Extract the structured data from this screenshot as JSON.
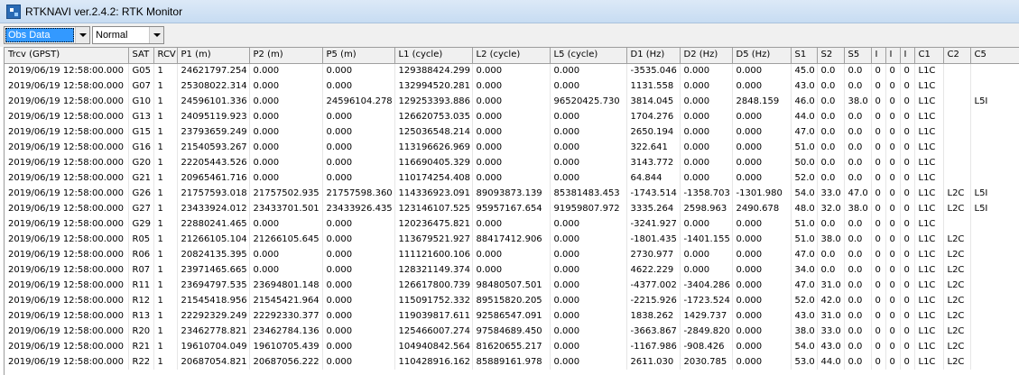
{
  "window": {
    "title": "RTKNAVI ver.2.4.2: RTK Monitor"
  },
  "toolbar": {
    "type_select": {
      "value": "Obs Data"
    },
    "mode_select": {
      "value": "Normal"
    }
  },
  "table": {
    "columns": [
      "Trcv (GPST)",
      "SAT",
      "RCV",
      "P1 (m)",
      "P2 (m)",
      "P5 (m)",
      "L1 (cycle)",
      "L2 (cycle)",
      "L5 (cycle)",
      "D1 (Hz)",
      "D2 (Hz)",
      "D5 (Hz)",
      "S1",
      "S2",
      "S5",
      "I",
      "I",
      "I",
      "C1",
      "C2",
      "C5"
    ],
    "rows": [
      [
        "2019/06/19 12:58:00.000",
        "G05",
        "1",
        "24621797.254",
        "0.000",
        "0.000",
        "129388424.299",
        "0.000",
        "0.000",
        "-3535.046",
        "0.000",
        "0.000",
        "45.0",
        "0.0",
        "0.0",
        "0",
        "0",
        "0",
        "L1C",
        "",
        ""
      ],
      [
        "2019/06/19 12:58:00.000",
        "G07",
        "1",
        "25308022.314",
        "0.000",
        "0.000",
        "132994520.281",
        "0.000",
        "0.000",
        "1131.558",
        "0.000",
        "0.000",
        "43.0",
        "0.0",
        "0.0",
        "0",
        "0",
        "0",
        "L1C",
        "",
        ""
      ],
      [
        "2019/06/19 12:58:00.000",
        "G10",
        "1",
        "24596101.336",
        "0.000",
        "24596104.278",
        "129253393.886",
        "0.000",
        "96520425.730",
        "3814.045",
        "0.000",
        "2848.159",
        "46.0",
        "0.0",
        "38.0",
        "0",
        "0",
        "0",
        "L1C",
        "",
        "L5I"
      ],
      [
        "2019/06/19 12:58:00.000",
        "G13",
        "1",
        "24095119.923",
        "0.000",
        "0.000",
        "126620753.035",
        "0.000",
        "0.000",
        "1704.276",
        "0.000",
        "0.000",
        "44.0",
        "0.0",
        "0.0",
        "0",
        "0",
        "0",
        "L1C",
        "",
        ""
      ],
      [
        "2019/06/19 12:58:00.000",
        "G15",
        "1",
        "23793659.249",
        "0.000",
        "0.000",
        "125036548.214",
        "0.000",
        "0.000",
        "2650.194",
        "0.000",
        "0.000",
        "47.0",
        "0.0",
        "0.0",
        "0",
        "0",
        "0",
        "L1C",
        "",
        ""
      ],
      [
        "2019/06/19 12:58:00.000",
        "G16",
        "1",
        "21540593.267",
        "0.000",
        "0.000",
        "113196626.969",
        "0.000",
        "0.000",
        "322.641",
        "0.000",
        "0.000",
        "51.0",
        "0.0",
        "0.0",
        "0",
        "0",
        "0",
        "L1C",
        "",
        ""
      ],
      [
        "2019/06/19 12:58:00.000",
        "G20",
        "1",
        "22205443.526",
        "0.000",
        "0.000",
        "116690405.329",
        "0.000",
        "0.000",
        "3143.772",
        "0.000",
        "0.000",
        "50.0",
        "0.0",
        "0.0",
        "0",
        "0",
        "0",
        "L1C",
        "",
        ""
      ],
      [
        "2019/06/19 12:58:00.000",
        "G21",
        "1",
        "20965461.716",
        "0.000",
        "0.000",
        "110174254.408",
        "0.000",
        "0.000",
        "64.844",
        "0.000",
        "0.000",
        "52.0",
        "0.0",
        "0.0",
        "0",
        "0",
        "0",
        "L1C",
        "",
        ""
      ],
      [
        "2019/06/19 12:58:00.000",
        "G26",
        "1",
        "21757593.018",
        "21757502.935",
        "21757598.360",
        "114336923.091",
        "89093873.139",
        "85381483.453",
        "-1743.514",
        "-1358.703",
        "-1301.980",
        "54.0",
        "33.0",
        "47.0",
        "0",
        "0",
        "0",
        "L1C",
        "L2C",
        "L5I"
      ],
      [
        "2019/06/19 12:58:00.000",
        "G27",
        "1",
        "23433924.012",
        "23433701.501",
        "23433926.435",
        "123146107.525",
        "95957167.654",
        "91959807.972",
        "3335.264",
        "2598.963",
        "2490.678",
        "48.0",
        "32.0",
        "38.0",
        "0",
        "0",
        "0",
        "L1C",
        "L2C",
        "L5I"
      ],
      [
        "2019/06/19 12:58:00.000",
        "G29",
        "1",
        "22880241.465",
        "0.000",
        "0.000",
        "120236475.821",
        "0.000",
        "0.000",
        "-3241.927",
        "0.000",
        "0.000",
        "51.0",
        "0.0",
        "0.0",
        "0",
        "0",
        "0",
        "L1C",
        "",
        ""
      ],
      [
        "2019/06/19 12:58:00.000",
        "R05",
        "1",
        "21266105.104",
        "21266105.645",
        "0.000",
        "113679521.927",
        "88417412.906",
        "0.000",
        "-1801.435",
        "-1401.155",
        "0.000",
        "51.0",
        "38.0",
        "0.0",
        "0",
        "0",
        "0",
        "L1C",
        "L2C",
        ""
      ],
      [
        "2019/06/19 12:58:00.000",
        "R06",
        "1",
        "20824135.395",
        "0.000",
        "0.000",
        "111121600.106",
        "0.000",
        "0.000",
        "2730.977",
        "0.000",
        "0.000",
        "47.0",
        "0.0",
        "0.0",
        "0",
        "0",
        "0",
        "L1C",
        "L2C",
        ""
      ],
      [
        "2019/06/19 12:58:00.000",
        "R07",
        "1",
        "23971465.665",
        "0.000",
        "0.000",
        "128321149.374",
        "0.000",
        "0.000",
        "4622.229",
        "0.000",
        "0.000",
        "34.0",
        "0.0",
        "0.0",
        "0",
        "0",
        "0",
        "L1C",
        "L2C",
        ""
      ],
      [
        "2019/06/19 12:58:00.000",
        "R11",
        "1",
        "23694797.535",
        "23694801.148",
        "0.000",
        "126617800.739",
        "98480507.501",
        "0.000",
        "-4377.002",
        "-3404.286",
        "0.000",
        "47.0",
        "31.0",
        "0.0",
        "0",
        "0",
        "0",
        "L1C",
        "L2C",
        ""
      ],
      [
        "2019/06/19 12:58:00.000",
        "R12",
        "1",
        "21545418.956",
        "21545421.964",
        "0.000",
        "115091752.332",
        "89515820.205",
        "0.000",
        "-2215.926",
        "-1723.524",
        "0.000",
        "52.0",
        "42.0",
        "0.0",
        "0",
        "0",
        "0",
        "L1C",
        "L2C",
        ""
      ],
      [
        "2019/06/19 12:58:00.000",
        "R13",
        "1",
        "22292329.249",
        "22292330.377",
        "0.000",
        "119039817.611",
        "92586547.091",
        "0.000",
        "1838.262",
        "1429.737",
        "0.000",
        "43.0",
        "31.0",
        "0.0",
        "0",
        "0",
        "0",
        "L1C",
        "L2C",
        ""
      ],
      [
        "2019/06/19 12:58:00.000",
        "R20",
        "1",
        "23462778.821",
        "23462784.136",
        "0.000",
        "125466007.274",
        "97584689.450",
        "0.000",
        "-3663.867",
        "-2849.820",
        "0.000",
        "38.0",
        "33.0",
        "0.0",
        "0",
        "0",
        "0",
        "L1C",
        "L2C",
        ""
      ],
      [
        "2019/06/19 12:58:00.000",
        "R21",
        "1",
        "19610704.049",
        "19610705.439",
        "0.000",
        "104940842.564",
        "81620655.217",
        "0.000",
        "-1167.986",
        "-908.426",
        "0.000",
        "54.0",
        "43.0",
        "0.0",
        "0",
        "0",
        "0",
        "L1C",
        "L2C",
        ""
      ],
      [
        "2019/06/19 12:58:00.000",
        "R22",
        "1",
        "20687054.821",
        "20687056.222",
        "0.000",
        "110428916.162",
        "85889161.978",
        "0.000",
        "2611.030",
        "2030.785",
        "0.000",
        "53.0",
        "44.0",
        "0.0",
        "0",
        "0",
        "0",
        "L1C",
        "L2C",
        ""
      ]
    ]
  }
}
